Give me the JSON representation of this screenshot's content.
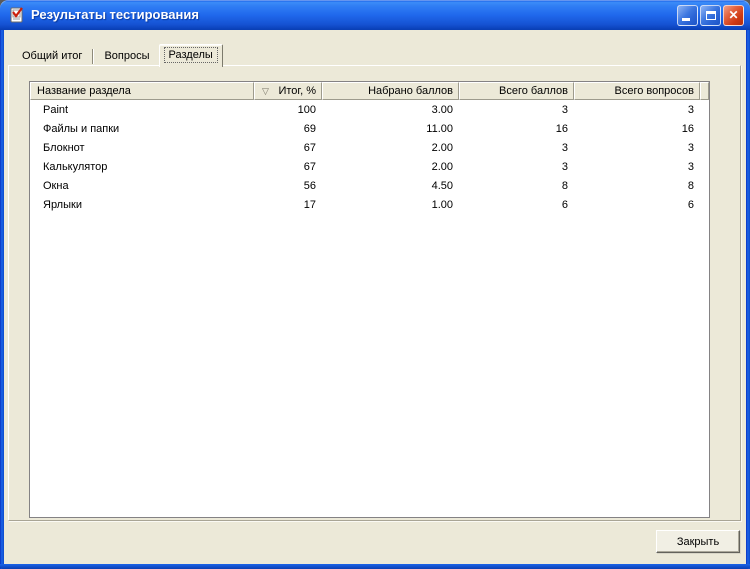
{
  "window": {
    "title": "Результаты тестирования"
  },
  "icons": {
    "close": "✕",
    "sort_descending_glyph": "▽"
  },
  "tabs": [
    {
      "label": "Общий итог",
      "selected": false
    },
    {
      "label": "Вопросы",
      "selected": false
    },
    {
      "label": "Разделы",
      "selected": true
    }
  ],
  "table": {
    "columns": [
      "Название раздела",
      "Итог, %",
      "Набрано баллов",
      "Всего баллов",
      "Всего вопросов"
    ],
    "sorted_column_index": 1,
    "sort_direction": "descending",
    "rows": [
      {
        "name": "Paint",
        "result": "100",
        "earned": "3.00",
        "total_points": "3",
        "total_questions": "3"
      },
      {
        "name": "Файлы и папки",
        "result": "69",
        "earned": "11.00",
        "total_points": "16",
        "total_questions": "16"
      },
      {
        "name": "Блокнот",
        "result": "67",
        "earned": "2.00",
        "total_points": "3",
        "total_questions": "3"
      },
      {
        "name": "Калькулятор",
        "result": "67",
        "earned": "2.00",
        "total_points": "3",
        "total_questions": "3"
      },
      {
        "name": "Окна",
        "result": "56",
        "earned": "4.50",
        "total_points": "8",
        "total_questions": "8"
      },
      {
        "name": "Ярлыки",
        "result": "17",
        "earned": "1.00",
        "total_points": "6",
        "total_questions": "6"
      }
    ]
  },
  "footer": {
    "close_button": "Закрыть"
  },
  "colors": {
    "titlebar_gradient_top": "#3C8CF8",
    "titlebar_gradient_bottom": "#0A3EB2",
    "window_frame_blue": "#1C64E8",
    "window_face": "#ECE9D8",
    "list_background": "#FFFFFF",
    "close_button_red": "#CE3913",
    "text": "#000000"
  }
}
